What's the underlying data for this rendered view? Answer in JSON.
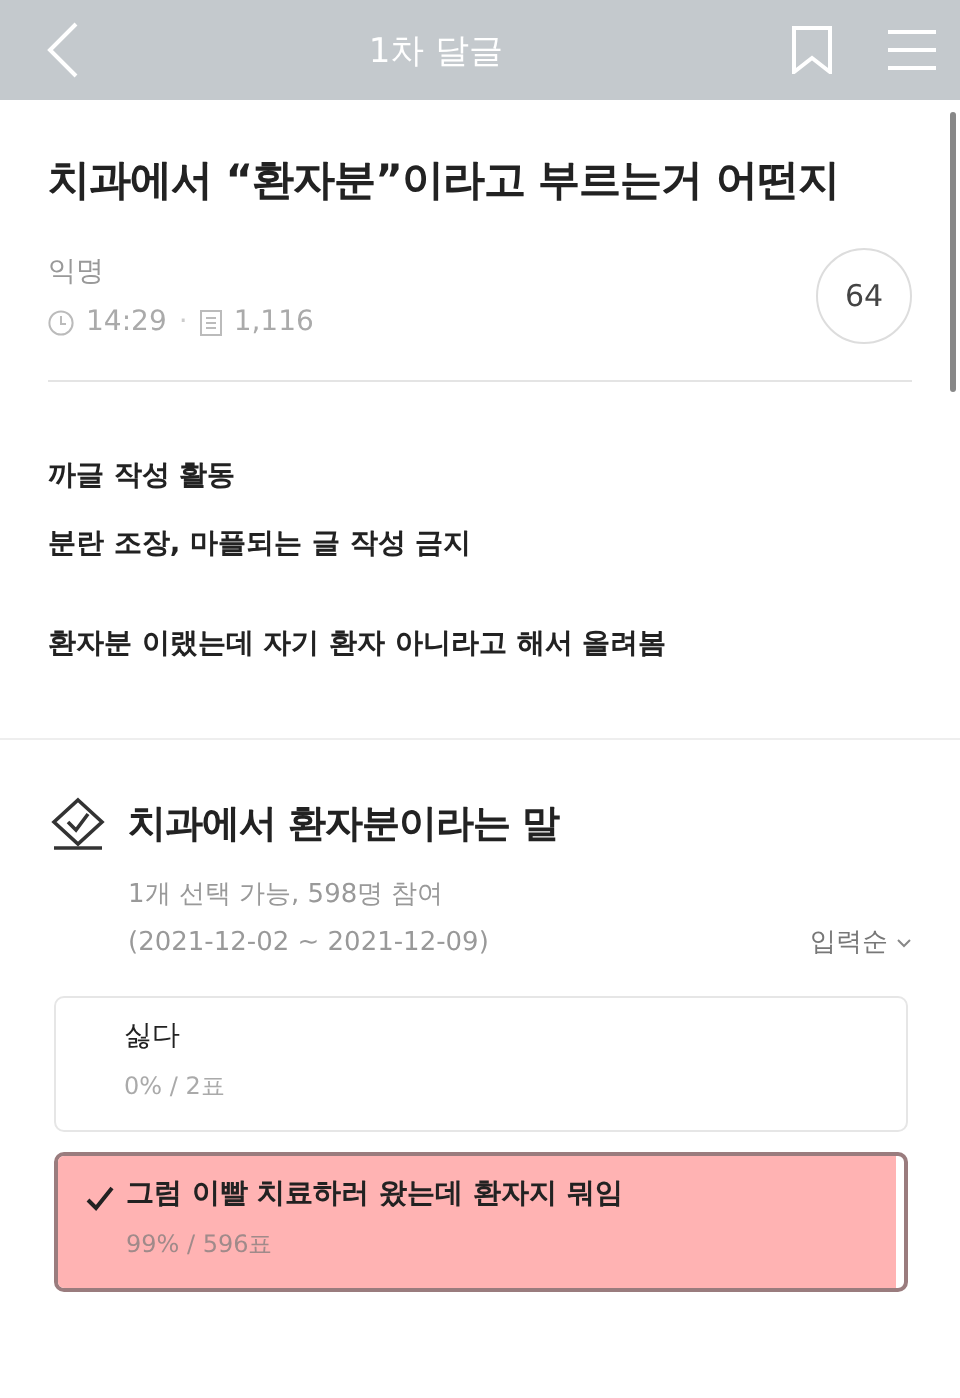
{
  "header": {
    "title": "1차 달글"
  },
  "post": {
    "title": "치과에서 “환자분”이라고 부르는거 어떤지",
    "author": "익명",
    "time": "14:29",
    "separator": "·",
    "views": "1,116",
    "comments": "64"
  },
  "body": [
    [
      "까글 작성 활동",
      "분란 조장, 마플되는 글 작성 금지"
    ],
    [
      "환자분 이랬는데 자기 환자 아니라고 해서 올려봄"
    ]
  ],
  "poll": {
    "title": "치과에서 환자분이라는 말",
    "info": "1개 선택 가능, 598명 참여",
    "period": "(2021-12-02 ~ 2021-12-09)",
    "sort": "입력순",
    "options": [
      {
        "label": "싫다",
        "result": "0% / 2표",
        "level": 0,
        "selected": false
      },
      {
        "label": "그럼 이빨 치료하러 왔는데 환자지 뭐임",
        "result": "99% / 596표",
        "level": 0.99,
        "selected": true
      }
    ]
  }
}
